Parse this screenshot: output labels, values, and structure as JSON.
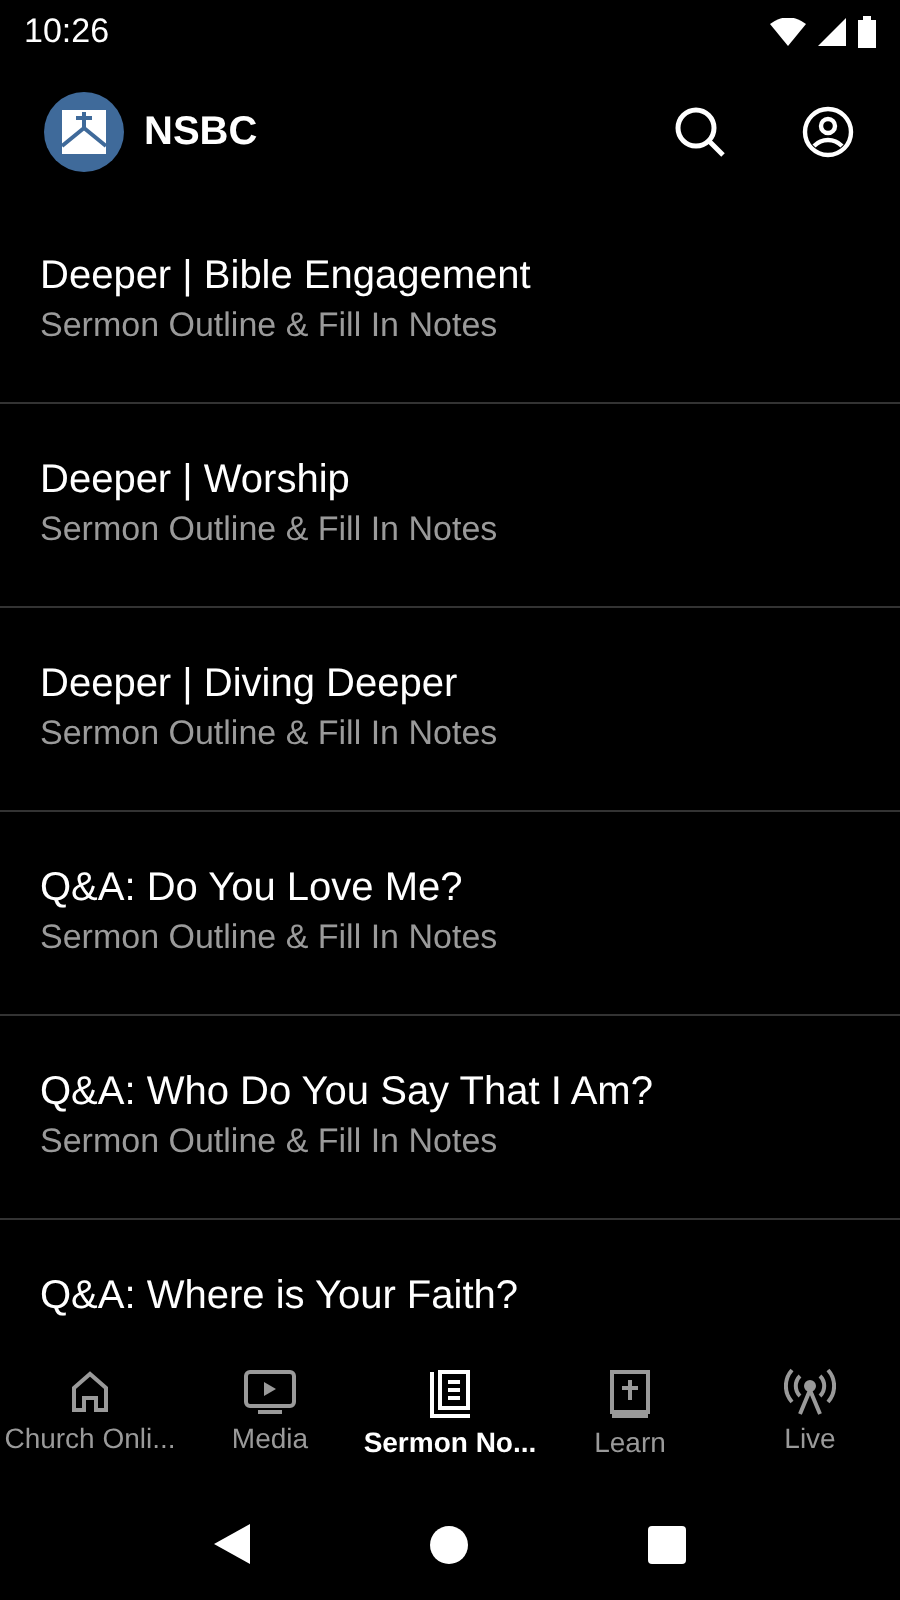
{
  "status_bar": {
    "time": "10:26"
  },
  "app_bar": {
    "title": "NSBC"
  },
  "sermons": [
    {
      "title": "Deeper | Bible Engagement",
      "subtitle": "Sermon Outline & Fill In Notes"
    },
    {
      "title": "Deeper | Worship",
      "subtitle": "Sermon Outline & Fill In Notes"
    },
    {
      "title": "Deeper | Diving Deeper",
      "subtitle": "Sermon Outline & Fill In Notes"
    },
    {
      "title": "Q&A: Do You Love Me?",
      "subtitle": "Sermon Outline & Fill In Notes"
    },
    {
      "title": "Q&A: Who Do You Say That I Am?",
      "subtitle": "Sermon Outline & Fill In Notes"
    },
    {
      "title": "Q&A: Where is Your Faith?"
    }
  ],
  "tabs": [
    {
      "label": "Church Onli...",
      "selected": false
    },
    {
      "label": "Media",
      "selected": false
    },
    {
      "label": "Sermon No...",
      "selected": true
    },
    {
      "label": "Learn",
      "selected": false
    },
    {
      "label": "Live",
      "selected": false
    }
  ]
}
